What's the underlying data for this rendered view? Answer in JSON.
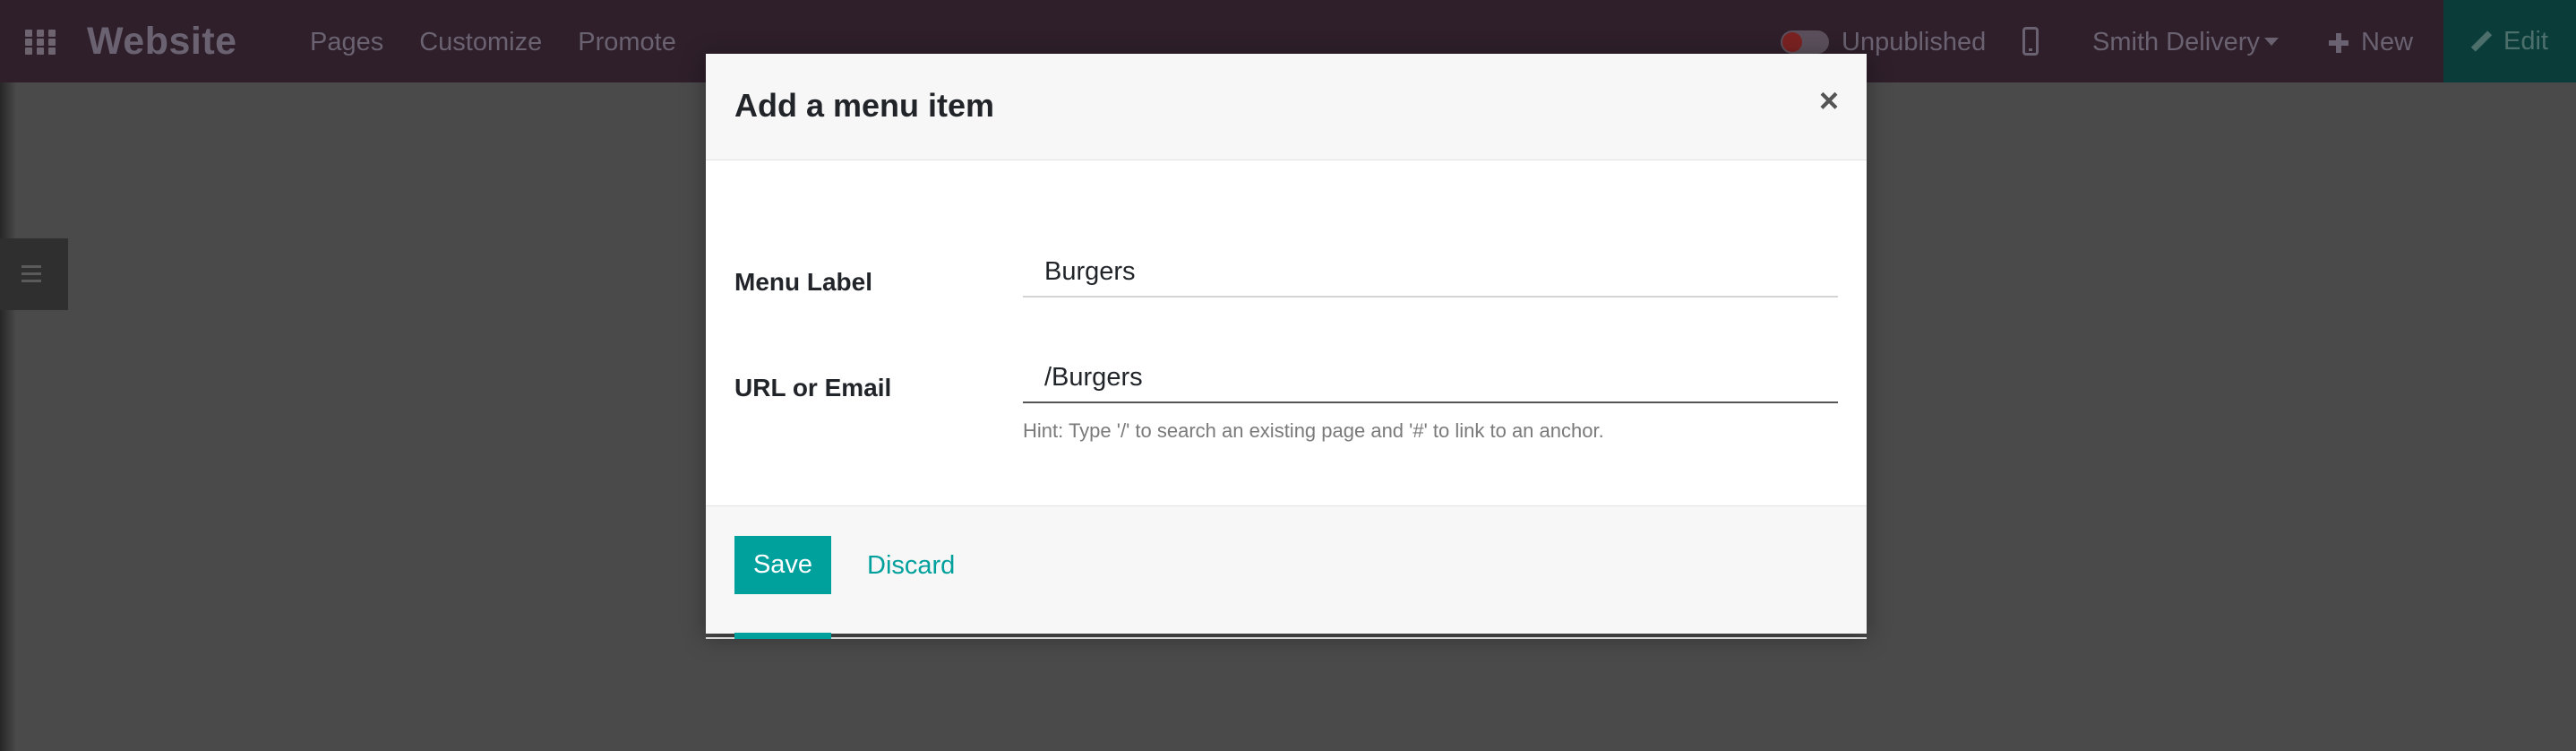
{
  "navbar": {
    "brand": "Website",
    "menu": [
      "Pages",
      "Customize",
      "Promote"
    ],
    "publish_status": "Unpublished",
    "website_switcher": "Smith Delivery",
    "new_label": "New",
    "edit_label": "Edit"
  },
  "modal": {
    "title": "Add a menu item",
    "close_symbol": "×",
    "fields": {
      "menu_label": {
        "label": "Menu Label",
        "value": "Burgers"
      },
      "url": {
        "label": "URL or Email",
        "value": "/Burgers",
        "hint": "Hint: Type '/' to search an existing page and '#' to link to an anchor."
      }
    },
    "save_label": "Save",
    "discard_label": "Discard"
  },
  "colors": {
    "primary": "#00a09d",
    "backdrop": "#4a4a4a",
    "navbar": "#2e1f2b"
  }
}
